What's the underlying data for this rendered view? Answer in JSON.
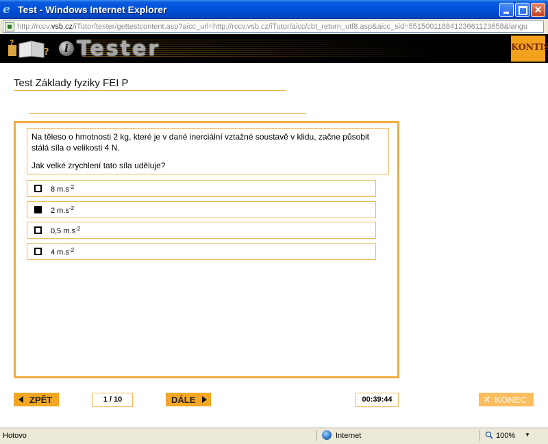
{
  "window": {
    "title": "Test - Windows Internet Explorer",
    "url_host": "http://rccv.",
    "url_domain": "vsb.cz",
    "url_rest": "/iTutor/tester/gettestcontent.asp?aicc_url=http://rccv.vsb.cz/iTutor/aicc/cbt_return_utf8.asp&aicc_sid=55150011884123661123658&langu"
  },
  "banner": {
    "brand": "iTester",
    "brand_letters": "Tester",
    "brand_i": "i",
    "partner_logo": "KONTIS"
  },
  "test": {
    "title": "Test Základy fyziky FEI P"
  },
  "question": {
    "text": "Na těleso o hmotnosti 2 kg, které je v dané inerciální vztažné soustavě v klidu, začne působit stálá síla o velikosti 4 N.",
    "prompt": "Jak velké zrychlení tato síla uděluje?"
  },
  "answers": [
    {
      "value": "8 m.s",
      "exp": "-2",
      "checked": false
    },
    {
      "value": "2 m.s",
      "exp": "-2",
      "checked": true
    },
    {
      "value": "0,5 m.s",
      "exp": "-2",
      "checked": false
    },
    {
      "value": "4 m.s",
      "exp": "-2",
      "checked": false
    }
  ],
  "nav": {
    "back_label": "ZPĚT",
    "pager": "1 / 10",
    "next_label": "DÁLE",
    "timer": "00:39:44",
    "end_label": "KONEC",
    "end_mark": "✕"
  },
  "statusbar": {
    "status": "Hotovo",
    "zone": "Internet",
    "zoom": "100%"
  },
  "icons": {
    "browser": "ie-icon",
    "minimize": "minimize-icon",
    "maximize": "maximize-icon",
    "close": "close-icon",
    "page": "page-icon",
    "globe": "globe-icon",
    "zoom": "magnifier-icon"
  },
  "colors": {
    "accent": "#f5a623",
    "border": "#f0b755",
    "titlebar": "#0050d8"
  }
}
